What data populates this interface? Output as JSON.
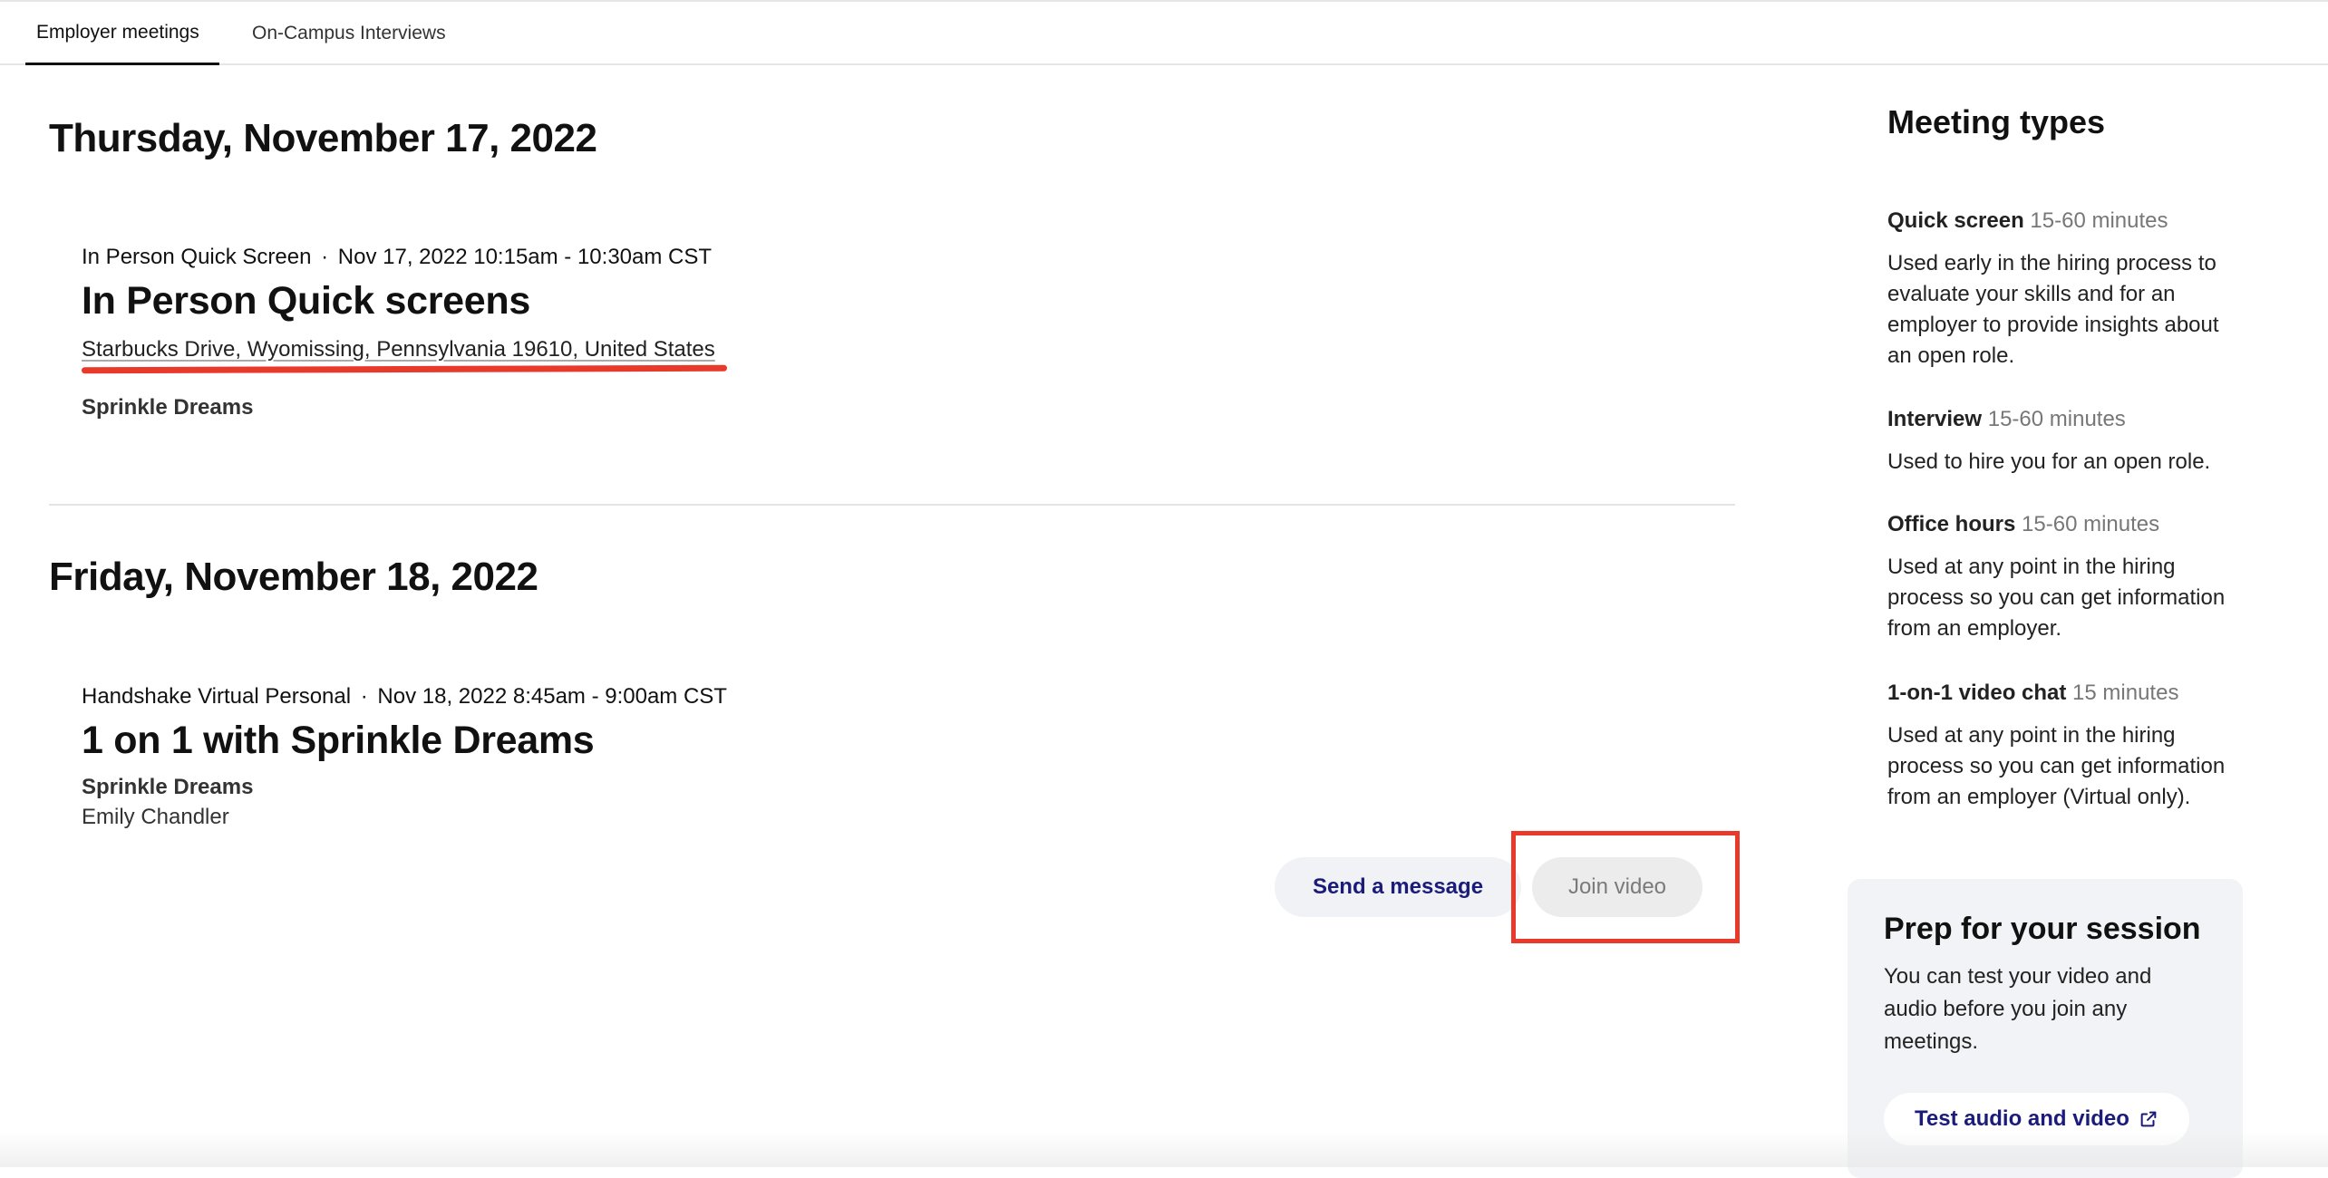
{
  "tabs": [
    {
      "label": "Employer meetings",
      "active": true
    },
    {
      "label": "On-Campus Interviews",
      "active": false
    }
  ],
  "days": [
    {
      "date": "Thursday, November 17, 2022",
      "meeting": {
        "type": "In Person Quick Screen",
        "separator": "·",
        "time": "Nov 17, 2022 10:15am - 10:30am CST",
        "title": "In Person Quick screens",
        "address": "Starbucks Drive, Wyomissing, Pennsylvania 19610, United States",
        "org": "Sprinkle Dreams"
      }
    },
    {
      "date": "Friday, November 18, 2022",
      "meeting": {
        "type": "Handshake Virtual Personal",
        "separator": "·",
        "time": "Nov 18, 2022 8:45am - 9:00am CST",
        "title": "1 on 1 with Sprinkle Dreams",
        "org": "Sprinkle Dreams",
        "person": "Emily Chandler",
        "actions": {
          "message": "Send a message",
          "join": "Join video"
        }
      }
    }
  ],
  "sidebar": {
    "title": "Meeting types",
    "types": [
      {
        "name": "Quick screen",
        "duration": "15-60 minutes",
        "desc": "Used early in the hiring process to evaluate your skills and for an employer to provide insights about an open role."
      },
      {
        "name": "Interview",
        "duration": "15-60 minutes",
        "desc": "Used to hire you for an open role."
      },
      {
        "name": "Office hours",
        "duration": "15-60 minutes",
        "desc": "Used at any point in the hiring process so you can get information from an employer."
      },
      {
        "name": "1-on-1 video chat",
        "duration": "15 minutes",
        "desc": "Used at any point in the hiring process so you can get information from an employer (Virtual only)."
      }
    ],
    "prep": {
      "title": "Prep for your session",
      "desc": "You can test your video and audio before you join any meetings.",
      "button": "Test audio and video",
      "icon": "external-link-icon"
    }
  },
  "colors": {
    "annotation": "#e8392a",
    "link": "#1b1b7a"
  }
}
